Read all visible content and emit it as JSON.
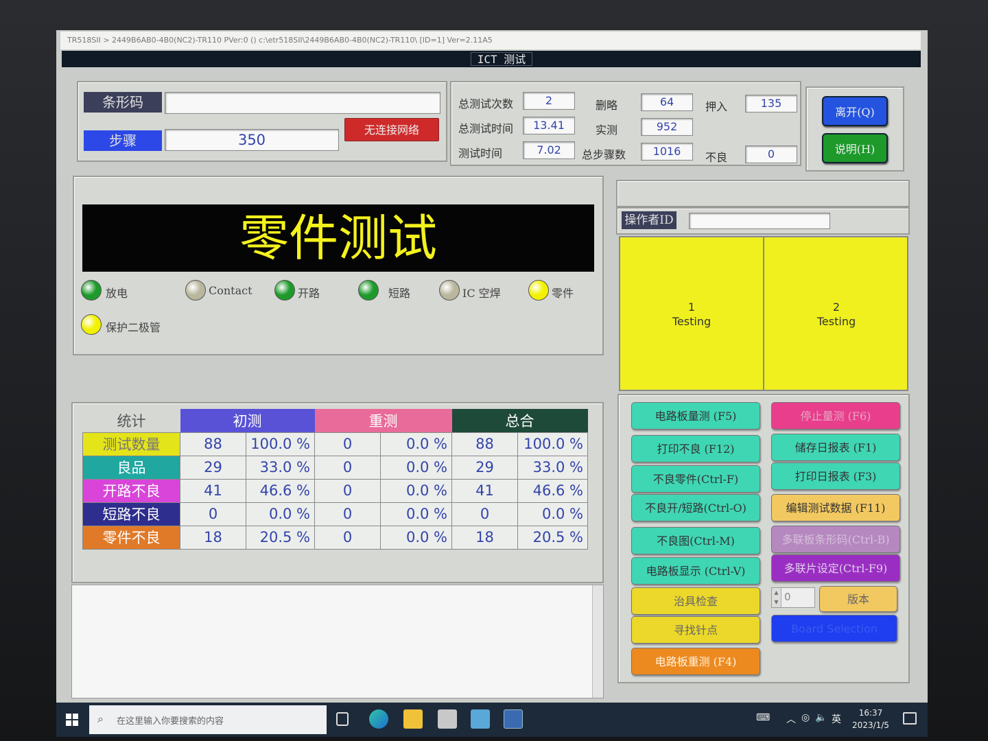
{
  "window": {
    "titlebar": "TR518SII > 2449B6AB0-4B0(NC2)-TR110 PVer:0 () c:\\etr518SII\\2449B6AB0-4B0(NC2)-TR110\\   [ID=1] Ver=2.11A5",
    "app_title": "ICT 测试"
  },
  "top_left": {
    "barcode_label": "条形码",
    "barcode_value": "",
    "step_label": "步骤",
    "step_value": "350",
    "network_button": "无连接网络"
  },
  "counters": {
    "total_tests_label": "总测试次数",
    "total_tests_value": "2",
    "total_time_label": "总测试时间",
    "total_time_value": "13.41",
    "test_time_label": "测试时间",
    "test_time_value": "7.02",
    "skip_label": "删略",
    "skip_value": "64",
    "measured_label": "实测",
    "measured_value": "952",
    "total_steps_label": "总步骤数",
    "total_steps_value": "1016",
    "press_label": "押入",
    "press_value": "135",
    "bad_label": "不良",
    "bad_value": "0"
  },
  "side_buttons": {
    "exit": "离开(Q)",
    "help": "说明(H)"
  },
  "status": {
    "banner": "零件测试",
    "leds": [
      {
        "label": "放电",
        "color": "#1e9a2a"
      },
      {
        "label": "Contact",
        "color": "#b8b69c"
      },
      {
        "label": "开路",
        "color": "#1e9a2a"
      },
      {
        "label": "短路",
        "color": "#1e9a2a"
      },
      {
        "label": "IC 空焊",
        "color": "#b8b69c"
      },
      {
        "label": "零件",
        "color": "#f2f200"
      },
      {
        "label": "保护二极管",
        "color": "#f2f200"
      }
    ]
  },
  "operator": {
    "label": "操作者ID",
    "value": ""
  },
  "boards": [
    {
      "num": "1",
      "state": "Testing"
    },
    {
      "num": "2",
      "state": "Testing"
    }
  ],
  "stats": {
    "header_stat": "统计",
    "header_first": "初测",
    "header_retest": "重测",
    "header_total": "总合",
    "rows": [
      {
        "label": "测试数量",
        "color": "#e4e41a",
        "tcolor": "#777",
        "v1": "88",
        "p1": "100.0 %",
        "v2": "0",
        "p2": "0.0 %",
        "v3": "88",
        "p3": "100.0 %"
      },
      {
        "label": "良品",
        "color": "#1fa7a0",
        "tcolor": "#fff",
        "v1": "29",
        "p1": "33.0 %",
        "v2": "0",
        "p2": "0.0 %",
        "v3": "29",
        "p3": "33.0 %"
      },
      {
        "label": "开路不良",
        "color": "#d845d8",
        "tcolor": "#fff",
        "v1": "41",
        "p1": "46.6 %",
        "v2": "0",
        "p2": "0.0 %",
        "v3": "41",
        "p3": "46.6 %"
      },
      {
        "label": "短路不良",
        "color": "#2e2e8e",
        "tcolor": "#fff",
        "v1": "0",
        "p1": "0.0 %",
        "v2": "0",
        "p2": "0.0 %",
        "v3": "0",
        "p3": "0.0 %"
      },
      {
        "label": "零件不良",
        "color": "#e07a28",
        "tcolor": "#fff",
        "v1": "18",
        "p1": "20.5 %",
        "v2": "0",
        "p2": "0.0 %",
        "v3": "18",
        "p3": "20.5 %"
      }
    ]
  },
  "fbuttons": {
    "f5": "电路板量测 (F5)",
    "f6": "停止量测 (F6)",
    "f12": "打印不良 (F12)",
    "f1": "储存日报表 (F1)",
    "ctrlf": "不良零件(Ctrl-F)",
    "f3": "打印日报表 (F3)",
    "ctrlo": "不良开/短路(Ctrl-O)",
    "f11": "编辑测试数据 (F11)",
    "ctrlm": "不良图(Ctrl-M)",
    "ctrlb": "多联板条形码(Ctrl-B)",
    "ctrlv": "电路板显示 (Ctrl-V)",
    "ctrlf9": "多联片设定(Ctrl-F9)",
    "fixture": "治具检查",
    "spin_value": "0",
    "version": "版本",
    "findpin": "寻找针点",
    "board_sel": "Board Selection",
    "f4": "电路板重测 (F4)"
  },
  "taskbar": {
    "search_placeholder": "在这里输入你要搜索的内容",
    "ime": "英",
    "time": "16:37",
    "date": "2023/1/5"
  }
}
